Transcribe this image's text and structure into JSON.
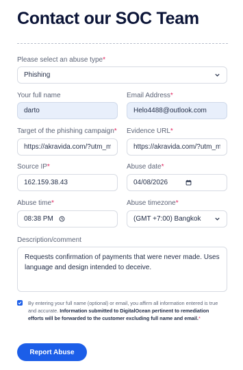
{
  "page_title": "Contact our SOC Team",
  "abuse_type": {
    "label": "Please select an abuse type",
    "value": "Phishing"
  },
  "full_name": {
    "label": "Your full name",
    "value": "darto"
  },
  "email": {
    "label": "Email Address",
    "value": "Helo4488@outlook.com"
  },
  "target": {
    "label": "Target of the phishing campaign",
    "value": "https://akravida.com/?utm_m"
  },
  "evidence": {
    "label": "Evidence URL",
    "value": "https://akravida.com/?utm_m"
  },
  "source_ip": {
    "label": "Source IP",
    "value": "162.159.38.43"
  },
  "abuse_date": {
    "label": "Abuse date",
    "value": "04/08/2026"
  },
  "abuse_time": {
    "label": "Abuse time",
    "value": "08:38 PM"
  },
  "timezone": {
    "label": "Abuse timezone",
    "value": "(GMT +7:00) Bangkok"
  },
  "description": {
    "label": "Description/comment",
    "value": "Requests confirmation of payments that were never made. Uses language and design intended to deceive."
  },
  "consent": {
    "text": "By entering your full name (optional) or email, you affirm all information entered is true and accurate.",
    "bold_text": "Information submitted to DigitalOcean pertinent to remediation efforts will be forwarded to the customer excluding full name and email.",
    "checked": true
  },
  "submit_label": "Report Abuse",
  "required_mark": "*",
  "colors": {
    "accent": "#1c5ee8",
    "required": "#e0245e",
    "filled_bg": "#e8effb"
  },
  "icons": {
    "select": "chevron-down-icon",
    "date": "calendar-icon",
    "time": "clock-icon",
    "check": "checkmark-icon"
  }
}
